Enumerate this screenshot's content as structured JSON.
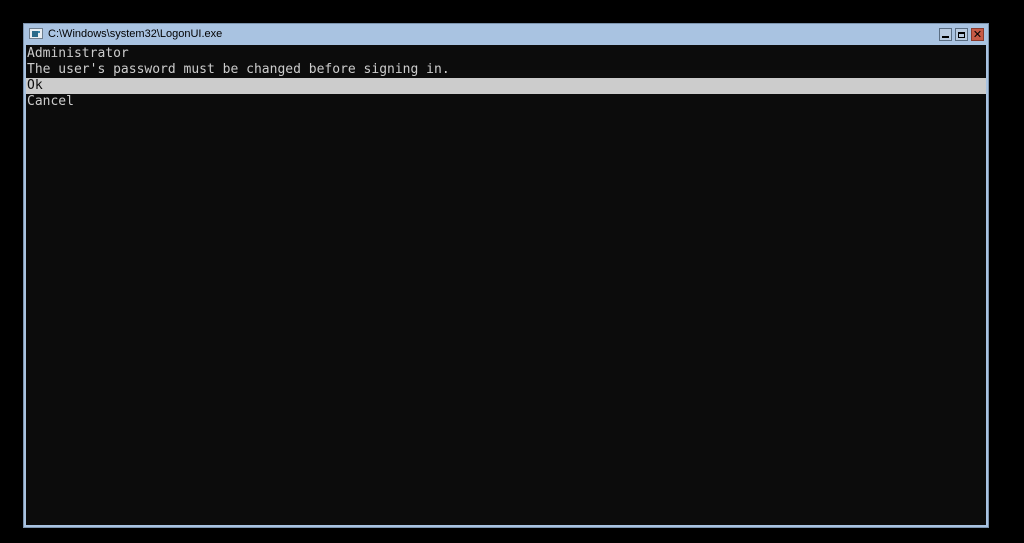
{
  "window": {
    "title": "C:\\Windows\\system32\\LogonUI.exe",
    "icon": "console-app-icon",
    "controls": {
      "minimize": "minimize-icon",
      "maximize": "maximize-icon",
      "close": "close-icon",
      "close_glyph": "✕"
    }
  },
  "console": {
    "username": "Administrator",
    "message": "The user's password must be changed before signing in.",
    "options": [
      {
        "label": "Ok",
        "selected": true
      },
      {
        "label": "Cancel",
        "selected": false
      }
    ]
  },
  "colors": {
    "frame": "#a9c3e1",
    "console_bg": "#0c0c0c",
    "console_fg": "#cccccc",
    "selection_bg": "#cccccc",
    "close_button": "#c75a46"
  }
}
